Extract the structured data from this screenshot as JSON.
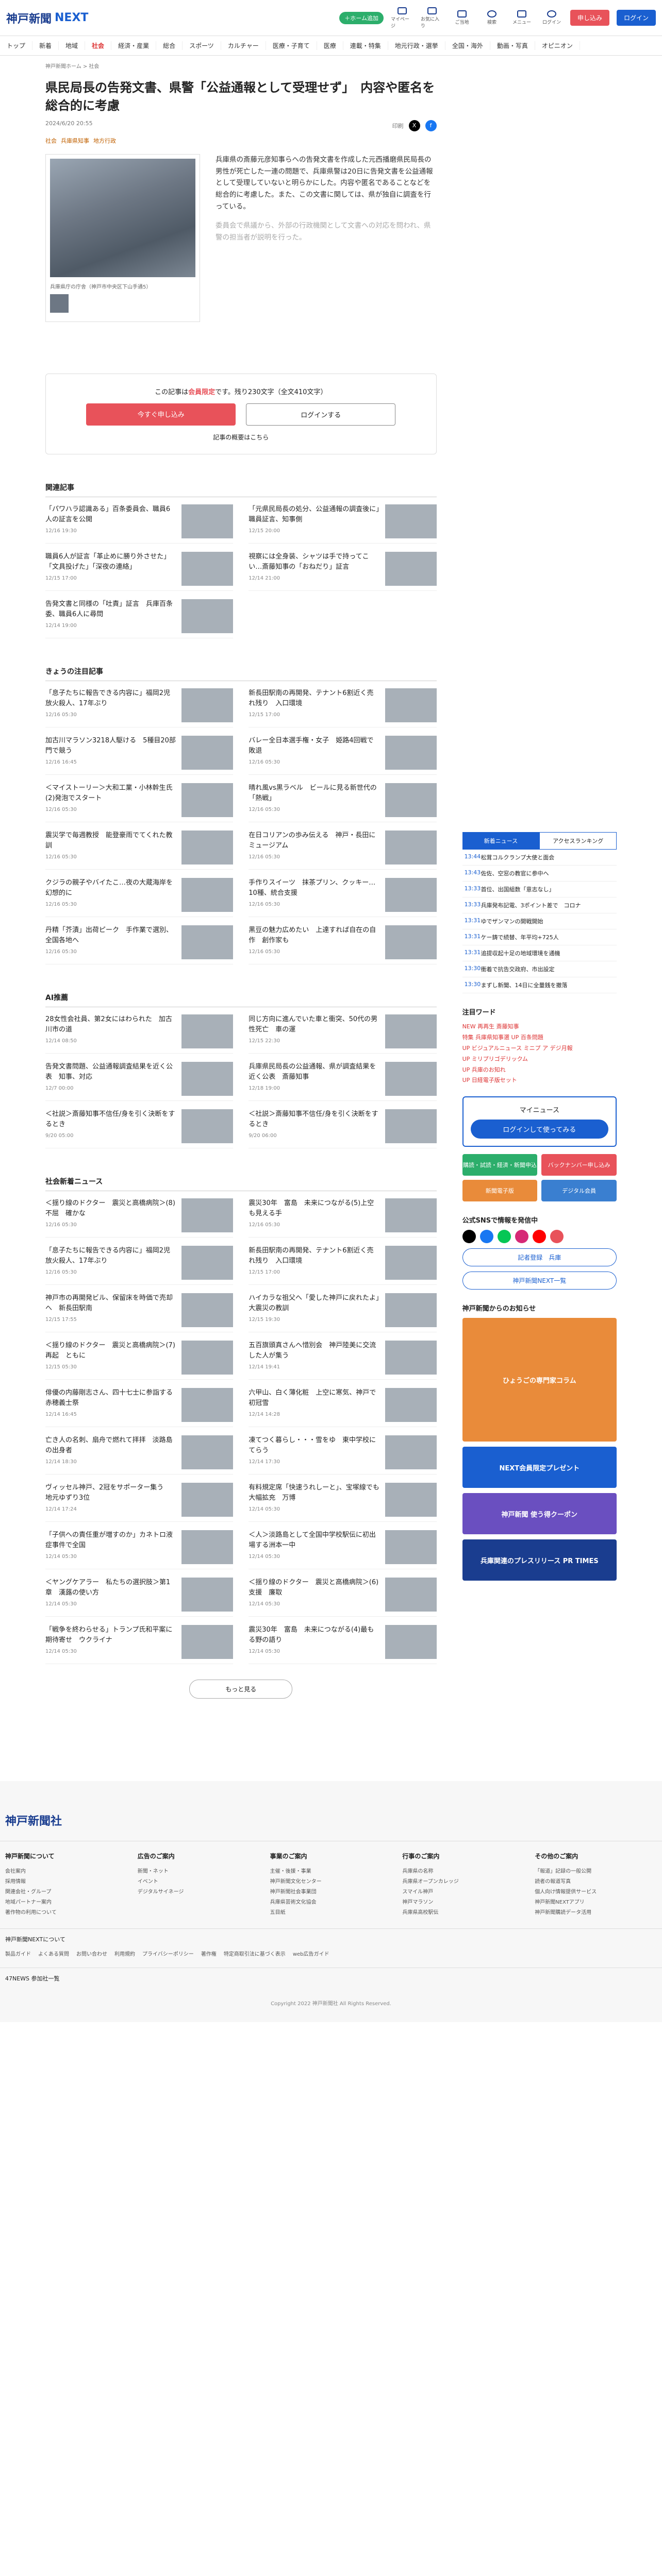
{
  "header": {
    "logo": "神戸新聞",
    "logo_next": "NEXT",
    "pill": "＋ホーム追加",
    "icons": [
      "マイページ",
      "お気に入り",
      "ご当地",
      "検索",
      "メニュー",
      "ログイン"
    ],
    "signup": "申し込み",
    "login": "ログイン"
  },
  "nav": [
    "トップ",
    "新着",
    "地域",
    "社会",
    "経済・産業",
    "総合",
    "スポーツ",
    "カルチャー",
    "医療・子育て",
    "医療",
    "連載・特集",
    "地元行政・選挙",
    "全国・海外",
    "動画・写真",
    "オピニオン"
  ],
  "nav_active": 3,
  "breadcrumb": "神戸新聞ホーム > 社会",
  "article": {
    "title": "県民局長の告発文書、県警「公益通報として受理せず」　内容や匿名を総合的に考慮",
    "date": "2024/6/20 20:55",
    "share_label": "印刷",
    "tags": [
      "社会",
      "兵庫県知事",
      "地方行政"
    ],
    "caption": "兵庫県庁の庁舎（神戸市中央区下山手通5）",
    "para1": "兵庫県の斎藤元彦知事らへの告発文書を作成した元西播磨県民局長の男性が死亡した一連の問題で、兵庫県警は20日に告発文書を公益通報として受理していないと明らかにした。内容や匿名であることなどを総合的に考慮した。また、この文書に関しては、県が独自に調査を行っている。",
    "para2": "委員会で県議から、外部の行政機関として文書への対応を問われ、県警の担当者が説明を行った。"
  },
  "paywall": {
    "text_a": "この記事は",
    "text_b": "会員限定",
    "text_c": "です。残り230文字（全文410文字）",
    "subscribe": "今すぐ申し込み",
    "login": "ログインする",
    "more": "記事の概要はこちら"
  },
  "related": {
    "heading": "関連記事",
    "items": [
      {
        "t": "「パワハラ認識ある」百条委員会、職員6人の証言を公開",
        "d": "12/16 19:30"
      },
      {
        "t": "「元県民局長の処分、公益通報の調査後に」職員証言、知事側",
        "d": "12/15 20:00"
      },
      {
        "t": "職員6人が証言「革止めに勝り外させた」「文具投げた」「深夜の連絡」",
        "d": "12/15 17:00"
      },
      {
        "t": "視察には全身装、シャツは手で持ってこい…斎藤知事の「おねだり」証言",
        "d": "12/14 21:00"
      },
      {
        "t": "告発文書と同様の「吐責」証言　兵庫百条委、職員6人に尋問",
        "d": "12/14 19:00"
      }
    ]
  },
  "today": {
    "heading": "きょうの注目記事",
    "items": [
      {
        "t": "「息子たちに報告できる内容に」福岡2児放火殺人、17年ぶり",
        "d": "12/16 05:30"
      },
      {
        "t": "新長田駅南の再開発、テナント6割近く売れ残り　入口環境",
        "d": "12/15 17:00"
      },
      {
        "t": "加古川マラソン3218人駆ける　5種目20部門で競う",
        "d": "12/16 16:45"
      },
      {
        "t": "バレー全日本選手権・女子　姫路4回戦で敗退",
        "d": "12/16 05:30"
      },
      {
        "t": "＜マイストーリー＞大和工業・小林幹生氏(2)発泡でスタート",
        "d": "12/16 05:30"
      },
      {
        "t": "晴れ風vs黒ラベル　ビールに見る新世代の「熱戦」",
        "d": "12/16 05:30"
      },
      {
        "t": "震災学で毎週教授　能登豪雨でてくれた教訓",
        "d": "12/16 05:30"
      },
      {
        "t": "在日コリアンの歩み伝える　神戸・長田にミュージアム",
        "d": "12/16 05:30"
      },
      {
        "t": "クジラの親子やバイたこ…夜の大蔵海岸を幻想的に",
        "d": "12/16 05:30"
      },
      {
        "t": "手作りスイーツ　抹茶プリン、クッキー…10種、統合支援",
        "d": "12/16 05:30"
      },
      {
        "t": "丹精「芥漬」出荷ピーク　手作業で選別、全国各地へ",
        "d": "12/16 05:30"
      },
      {
        "t": "黒豆の魅力広めたい　上達すれば自在の自作　創作家も",
        "d": "12/16 05:30"
      }
    ]
  },
  "ai": {
    "heading": "AI推薦",
    "items": [
      {
        "t": "28女性会社員、第2女にはわられた　加古川市の道",
        "d": "12/14 08:50"
      },
      {
        "t": "同じ方向に進んでいた車と衝突、50代の男性死亡　車の運",
        "d": "12/15 22:30"
      },
      {
        "t": "告発文書問題、公益通報調査結果を近く公表　知事、対応",
        "d": "12/7 00:00"
      },
      {
        "t": "兵庫県民局長の公益通報、県が調査結果を近く公表　斎藤知事",
        "d": "12/18 19:00"
      },
      {
        "t": "＜社説＞斎藤知事不信任/身を引く決断をするとき",
        "d": "9/20 05:00"
      },
      {
        "t": "＜社説＞斎藤知事不信任/身を引く決断をするとき",
        "d": "9/20 06:00"
      }
    ]
  },
  "society": {
    "heading": "社会新着ニュース",
    "items": [
      {
        "t": "＜揺り線のドクター　震災と高橋病院＞(8)不屈　確かな",
        "d": "12/16 05:30"
      },
      {
        "t": "震災30年　富島　未来につながる(5)上空も見える手",
        "d": "12/16 05:30"
      },
      {
        "t": "「息子たちに報告できる内容に」福岡2児放火殺人、17年ぶり",
        "d": "12/16 05:30"
      },
      {
        "t": "新長田駅南の再開発、テナント6割近く売れ残り　入口環境",
        "d": "12/15 17:00"
      },
      {
        "t": "神戸市の再開発ビル、保留床を時価で売却へ　新長田駅南",
        "d": "12/15 17:55"
      },
      {
        "t": "ハイカラな祖父へ「愛した神戸に戻れたよ」　大震災の教訓",
        "d": "12/15 19:30"
      },
      {
        "t": "＜揺り線のドクター　震災と高橋病院＞(7)再起　ともに",
        "d": "12/15 05:30"
      },
      {
        "t": "五百旗頭真さんへ惜別会　神戸陸美に交流した人が集う",
        "d": "12/14 19:41"
      },
      {
        "t": "俳優の内藤剛志さん、四十七士に参詣する　赤穂義士祭",
        "d": "12/14 16:45"
      },
      {
        "t": "六甲山、白く薄化粧　上空に寒気、神戸で初冠雪",
        "d": "12/14 14:28"
      },
      {
        "t": "亡き人の名刺、扇舟で燃れて拝拝　淡路島の出身者",
        "d": "12/14 18:30"
      },
      {
        "t": "凍てつく暮らし・・・雪をゆ　東中学校にてらう",
        "d": "12/14 17:30"
      },
      {
        "t": "ヴィッセル神戸、2冠をサポーター集う　地元ゆずり3位",
        "d": "12/14 17:24"
      },
      {
        "t": "有料規定席「快速うれしーと」、宝塚線でも大幅拡充　万博",
        "d": "12/14 05:30"
      },
      {
        "t": "「子供への責任重が増すのか」カネトロ液症事件で全国",
        "d": "12/14 05:30"
      },
      {
        "t": "＜人＞淡路島として全国中学校駅伝に初出場する洲本一中",
        "d": "12/14 05:30"
      },
      {
        "t": "＜ヤングケアラー　私たちの選択肢＞第1章　漢蕗の使い方",
        "d": "12/14 05:30"
      },
      {
        "t": "＜揺り線のドクター　震災と高橋病院＞(6)支援　廉取",
        "d": "12/14 05:30"
      },
      {
        "t": "「戦争を終わらせる」トランプ氏和平案に期待寄せ　ウクライナ",
        "d": "12/14 05:30"
      },
      {
        "t": "震災30年　富島　未来につながる(4)最もる野の語り",
        "d": "12/14 05:30"
      }
    ],
    "more": "もっと見る"
  },
  "side": {
    "tab1": "新着ニュース",
    "tab2": "アクセスランキング",
    "rank": [
      {
        "n": "13:44",
        "t": "松茸コルクランプ大使と面会"
      },
      {
        "n": "13:43",
        "t": "佐佐、空窓の教官に参中へ"
      },
      {
        "n": "13:33",
        "t": "首位、出国組数「意志なし」"
      },
      {
        "n": "13:33",
        "t": "兵庫発布記電、3ポイント差で　コロナ"
      },
      {
        "n": "13:31",
        "t": "ゆでザンマンの開戦開始"
      },
      {
        "n": "13:31",
        "t": "ケー鋳で続替、年平均+725人"
      },
      {
        "n": "13:31",
        "t": "追提収起十足の地域環境を通機"
      },
      {
        "n": "13:30",
        "t": "衝着で抗告交政府、市出設定"
      },
      {
        "n": "13:30",
        "t": "まずし新聞、14日に全量銭を撤落"
      }
    ],
    "kw_heading": "注目ワード",
    "keywords": "NEW 再再生 斎藤知事\n特集 兵庫県知事選 UP 百条問題\nUP ビジュアルニュース ミニプ ア デジ月報\nUP ミリプリゴデリックム\nUP 兵庫のお知れ\nUP 日経電子版セット",
    "my": "マイニュース",
    "my_btn": "ログインして使ってみる",
    "svc": [
      "購読・試読・経済・新聞申込",
      "バックナンバー申し込み",
      "新聞電子版",
      "デジタル会員"
    ],
    "sns_heading": "公式SNSで情報を発信中",
    "link1": "記者登録　兵庫",
    "link2": "神戸新聞NEXT一覧",
    "notice_heading": "神戸新聞からのお知らせ",
    "banner1": "ひょうごの専門家コラム",
    "banner2": "NEXT会員限定プレゼント",
    "banner3": "神戸新聞 使う得クーポン",
    "banner4": "兵庫関連のプレスリリース PR TIMES"
  },
  "footer": {
    "logo": "神戸新聞社",
    "cols": [
      {
        "h": "神戸新聞について",
        "items": [
          "会社案内",
          "採用情報",
          "関連会社・グループ",
          "地域パートナー案内",
          "著作物の利用について"
        ]
      },
      {
        "h": "広告のご案内",
        "items": [
          "新聞・ネット",
          "イベント",
          "デジタルサイネージ"
        ]
      },
      {
        "h": "事業のご案内",
        "items": [
          "主催・後援・事業",
          "神戸新聞文化センター",
          "神戸新聞社会事業団",
          "兵庫県芸術文化協会",
          "五目紙"
        ]
      },
      {
        "h": "行事のご案内",
        "items": [
          "兵庫県の名称",
          "兵庫県オープンカレッジ",
          "スマイル神戸",
          "神戸マラソン",
          "兵庫県高校駅伝"
        ]
      },
      {
        "h": "その他のご案内",
        "items": [
          "「報道」記録の一般公開",
          "読者の報道写真",
          "個人向け情報提供サービス",
          "神戸新聞NEXTアプリ",
          "神戸新聞購読データ活用"
        ]
      }
    ],
    "next_heading": "神戸新聞NEXTについて",
    "links": [
      "製品ガイド",
      "よくある質問",
      "お問い合わせ",
      "利用規約",
      "プライバシーポリシー",
      "著作権",
      "特定商取引法に基づく表示",
      "web広告ガイド"
    ],
    "news47": "47NEWS 参加社一覧",
    "copyright": "Copyright 2022 神戸新聞社 All Rights Reserved."
  }
}
